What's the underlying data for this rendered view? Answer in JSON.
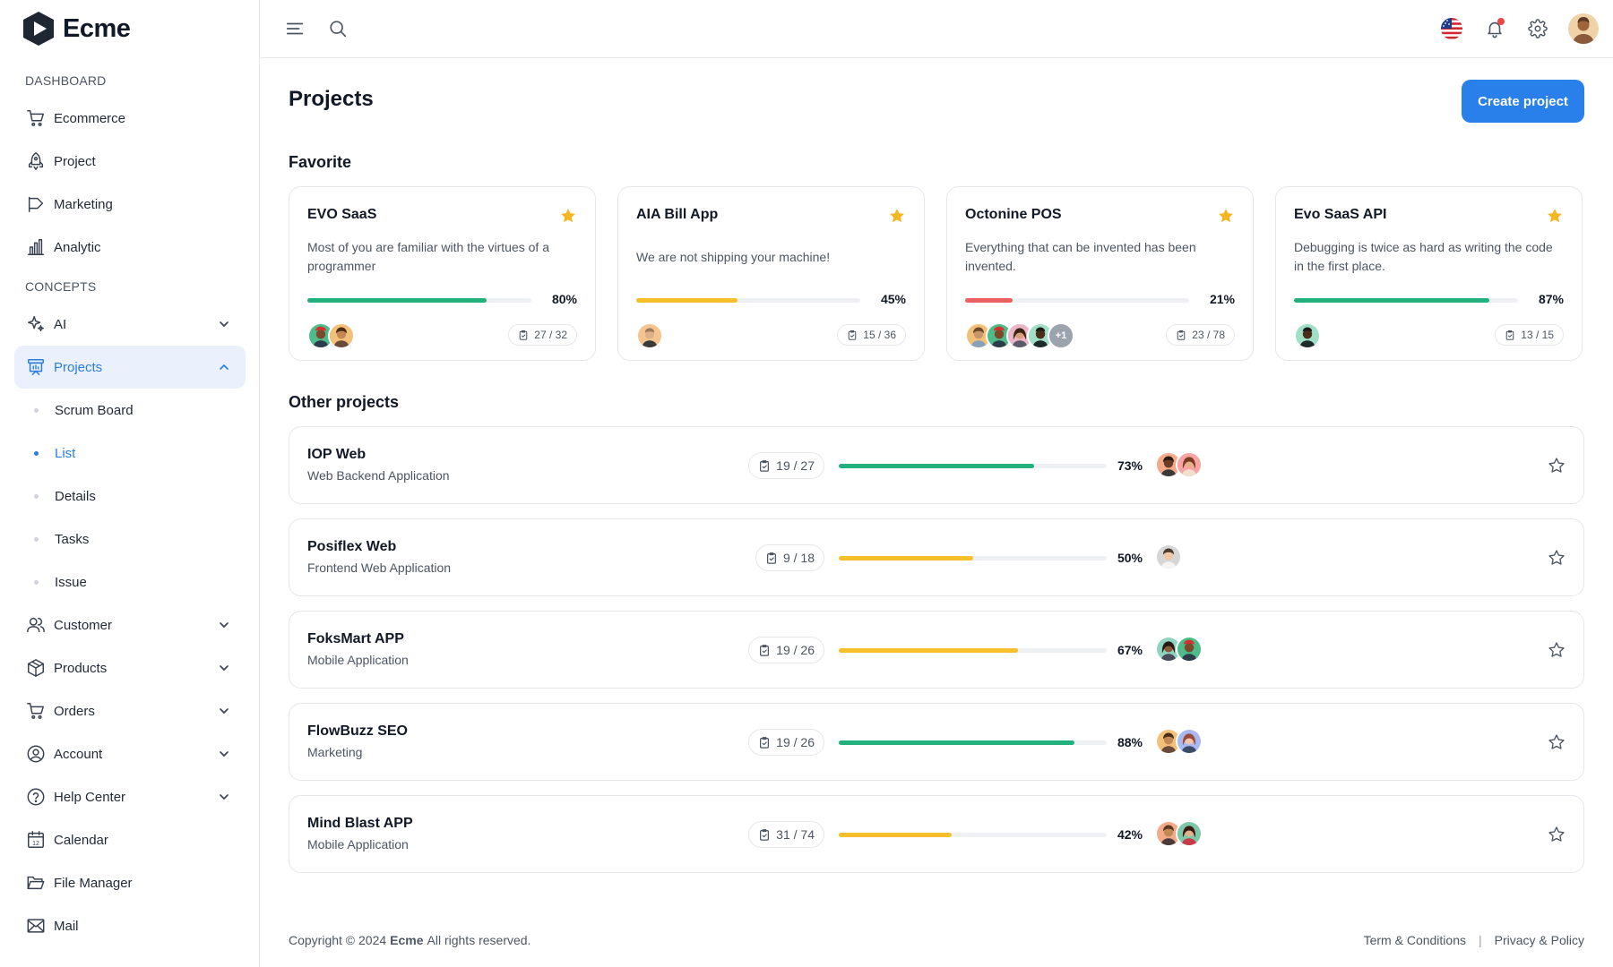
{
  "app": {
    "name": "Ecme"
  },
  "sidebar": {
    "sections": [
      {
        "title": "DASHBOARD"
      },
      {
        "title": "CONCEPTS"
      }
    ],
    "dashboard_items": [
      {
        "label": "Ecommerce",
        "icon": "cart-icon"
      },
      {
        "label": "Project",
        "icon": "rocket-icon"
      },
      {
        "label": "Marketing",
        "icon": "megaphone-icon"
      },
      {
        "label": "Analytic",
        "icon": "bar-chart-icon"
      }
    ],
    "concept_items": [
      {
        "label": "AI",
        "icon": "sparkle-icon",
        "expanded": false
      },
      {
        "label": "Projects",
        "icon": "presentation-icon",
        "expanded": true,
        "active": true
      },
      {
        "label": "Customer",
        "icon": "users-icon"
      },
      {
        "label": "Products",
        "icon": "box-icon"
      },
      {
        "label": "Orders",
        "icon": "cart-icon"
      },
      {
        "label": "Account",
        "icon": "user-circle-icon"
      },
      {
        "label": "Help Center",
        "icon": "help-circle-icon"
      },
      {
        "label": "Calendar",
        "icon": "calendar-icon"
      },
      {
        "label": "File Manager",
        "icon": "folder-icon"
      },
      {
        "label": "Mail",
        "icon": "mail-icon"
      }
    ],
    "project_sub_items": [
      {
        "label": "Scrum Board"
      },
      {
        "label": "List",
        "active": true
      },
      {
        "label": "Details"
      },
      {
        "label": "Tasks"
      },
      {
        "label": "Issue"
      }
    ],
    "calendar_day": "12"
  },
  "header": {
    "left_icons": [
      "menu-icon",
      "search-icon"
    ],
    "right_icons": [
      "us-flag-icon",
      "bell-icon",
      "gear-icon",
      "avatar"
    ]
  },
  "main": {
    "title": "Projects",
    "create_button": "Create project",
    "favorite_title": "Favorite",
    "other_title": "Other projects",
    "favorites": [
      {
        "name": "EVO SaaS",
        "desc": "Most of you are familiar with the virtues of a programmer",
        "progress": 80,
        "progress_label": "80%",
        "tasks": "27 / 32",
        "color": "#22b07d",
        "members": 2,
        "extra": ""
      },
      {
        "name": "AIA Bill App",
        "desc": "We are not shipping your machine!",
        "progress": 45,
        "progress_label": "45%",
        "tasks": "15 / 36",
        "color": "#f5c02a",
        "members": 1,
        "extra": ""
      },
      {
        "name": "Octonine POS",
        "desc": "Everything that can be invented has been invented.",
        "progress": 21,
        "progress_label": "21%",
        "tasks": "23 / 78",
        "color": "#ec6160",
        "members": 4,
        "extra": "+1"
      },
      {
        "name": "Evo SaaS API",
        "desc": "Debugging is twice as hard as writing the code in the first place.",
        "progress": 87,
        "progress_label": "87%",
        "tasks": "13 / 15",
        "color": "#22b07d",
        "members": 1,
        "extra": ""
      }
    ],
    "others": [
      {
        "name": "IOP Web",
        "category": "Web Backend Application",
        "tasks": "19 / 27",
        "progress": 73,
        "progress_label": "73%",
        "color": "#22b07d",
        "members": 2
      },
      {
        "name": "Posiflex Web",
        "category": "Frontend Web Application",
        "tasks": "9 / 18",
        "progress": 50,
        "progress_label": "50%",
        "color": "#f5c02a",
        "members": 1
      },
      {
        "name": "FoksMart APP",
        "category": "Mobile Application",
        "tasks": "19 / 26",
        "progress": 67,
        "progress_label": "67%",
        "color": "#f5c02a",
        "members": 2
      },
      {
        "name": "FlowBuzz SEO",
        "category": "Marketing",
        "tasks": "19 / 26",
        "progress": 88,
        "progress_label": "88%",
        "color": "#22b07d",
        "members": 2
      },
      {
        "name": "Mind Blast APP",
        "category": "Mobile Application",
        "tasks": "31 / 74",
        "progress": 42,
        "progress_label": "42%",
        "color": "#f5c02a",
        "members": 2
      }
    ]
  },
  "footer": {
    "copyright_pre": "Copyright © 2024",
    "brand": "Ecme",
    "copyright_post": "All rights reserved.",
    "links": [
      "Term & Conditions",
      "Privacy & Policy"
    ]
  },
  "colors": {
    "accent": "#2a80ea",
    "active_bg": "#eaf1fd",
    "star": "#f5b71f",
    "green": "#22b07d",
    "yellow": "#f5c02a",
    "red": "#ec6160"
  }
}
